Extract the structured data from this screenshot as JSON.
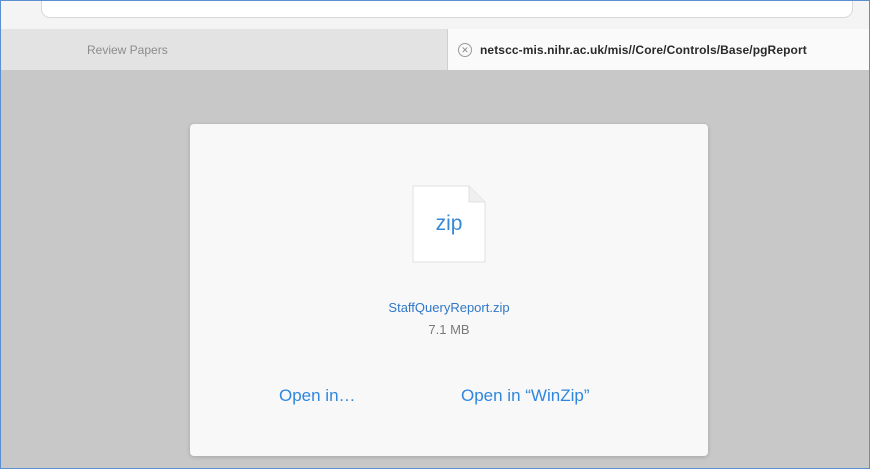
{
  "browser": {
    "tabs": [
      {
        "label": "Review Papers",
        "active": false
      },
      {
        "label": "netscc-mis.nihr.ac.uk/mis//Core/Controls/Base/pgReport",
        "active": true
      }
    ]
  },
  "download": {
    "file_type_label": "zip",
    "file_name": "StaffQueryReport.zip",
    "file_size": "7.1 MB",
    "actions": {
      "open_in": "Open in…",
      "open_in_app": "Open in “WinZip”"
    }
  },
  "colors": {
    "accent": "#2f86df",
    "overlay_bg": "#c8c8c8",
    "sheet_bg": "#f8f8f8",
    "frame_border": "#5b8fd0"
  },
  "icons": {
    "tab_close": "close-circle-icon",
    "file": "zip-file-icon"
  }
}
